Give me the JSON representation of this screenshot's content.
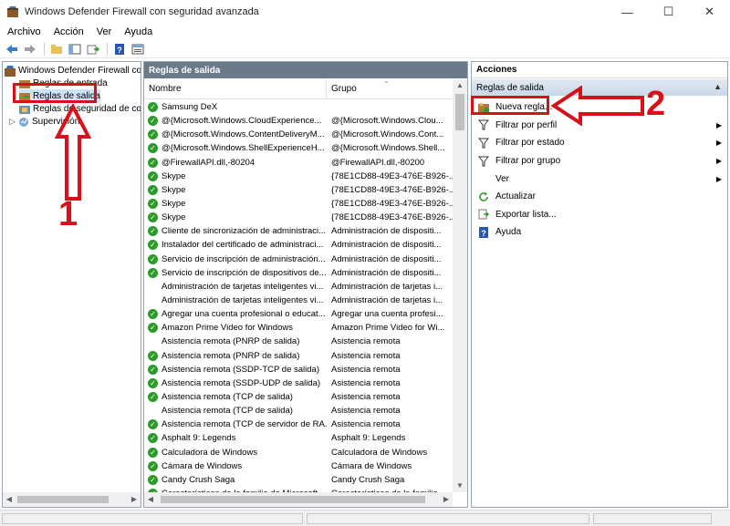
{
  "window": {
    "title": "Windows Defender Firewall con seguridad avanzada",
    "controls": [
      "minimize-icon",
      "maximize-icon",
      "close-icon"
    ]
  },
  "menu": [
    "Archivo",
    "Acción",
    "Ver",
    "Ayuda"
  ],
  "toolbar": [
    "back-icon",
    "forward-icon",
    "up-folder-icon",
    "show-hide-tree-icon",
    "export-icon",
    "help-icon",
    "properties-icon"
  ],
  "tree": {
    "root": "Windows Defender Firewall con",
    "items": [
      "Reglas de entrada",
      "Reglas de salida",
      "Reglas de seguridad de con",
      "Supervisión"
    ]
  },
  "middle": {
    "header": "Reglas de salida",
    "columns": {
      "name": "Nombre",
      "group": "Grupo"
    },
    "rows": [
      {
        "name": "Samsung DeX",
        "group": "",
        "enabled": true
      },
      {
        "name": "@{Microsoft.Windows.CloudExperience...",
        "group": "@{Microsoft.Windows.Clou...",
        "enabled": true
      },
      {
        "name": "@{Microsoft.Windows.ContentDeliveryM...",
        "group": "@{Microsoft.Windows.Cont...",
        "enabled": true
      },
      {
        "name": "@{Microsoft.Windows.ShellExperienceH...",
        "group": "@{Microsoft.Windows.Shell...",
        "enabled": true
      },
      {
        "name": "@FirewallAPI.dll,-80204",
        "group": "@FirewallAPI.dll,-80200",
        "enabled": true
      },
      {
        "name": "Skype",
        "group": "{78E1CD88-49E3-476E-B926-...",
        "enabled": true
      },
      {
        "name": "Skype",
        "group": "{78E1CD88-49E3-476E-B926-...",
        "enabled": true
      },
      {
        "name": "Skype",
        "group": "{78E1CD88-49E3-476E-B926-...",
        "enabled": true
      },
      {
        "name": "Skype",
        "group": "{78E1CD88-49E3-476E-B926-...",
        "enabled": true
      },
      {
        "name": "Cliente de sincronización de administraci...",
        "group": "Administración de dispositi...",
        "enabled": true
      },
      {
        "name": "Instalador del certificado de administraci...",
        "group": "Administración de dispositi...",
        "enabled": true
      },
      {
        "name": "Servicio de inscripción de administración...",
        "group": "Administración de dispositi...",
        "enabled": true
      },
      {
        "name": "Servicio de inscripción de dispositivos de...",
        "group": "Administración de dispositi...",
        "enabled": true
      },
      {
        "name": "Administración de tarjetas inteligentes vi...",
        "group": "Administración de tarjetas i...",
        "enabled": false
      },
      {
        "name": "Administración de tarjetas inteligentes vi...",
        "group": "Administración de tarjetas i...",
        "enabled": false
      },
      {
        "name": "Agregar una cuenta profesional o educat...",
        "group": "Agregar una cuenta profesi...",
        "enabled": true
      },
      {
        "name": "Amazon Prime Video for Windows",
        "group": "Amazon Prime Video for Wi...",
        "enabled": true
      },
      {
        "name": "Asistencia remota (PNRP de salida)",
        "group": "Asistencia remota",
        "enabled": false
      },
      {
        "name": "Asistencia remota (PNRP de salida)",
        "group": "Asistencia remota",
        "enabled": true
      },
      {
        "name": "Asistencia remota (SSDP-TCP de salida)",
        "group": "Asistencia remota",
        "enabled": true
      },
      {
        "name": "Asistencia remota (SSDP-UDP de salida)",
        "group": "Asistencia remota",
        "enabled": true
      },
      {
        "name": "Asistencia remota (TCP de salida)",
        "group": "Asistencia remota",
        "enabled": true
      },
      {
        "name": "Asistencia remota (TCP de salida)",
        "group": "Asistencia remota",
        "enabled": false
      },
      {
        "name": "Asistencia remota (TCP de servidor de RA...",
        "group": "Asistencia remota",
        "enabled": true
      },
      {
        "name": "Asphalt 9: Legends",
        "group": "Asphalt 9: Legends",
        "enabled": true
      },
      {
        "name": "Calculadora de Windows",
        "group": "Calculadora de Windows",
        "enabled": true
      },
      {
        "name": "Cámara de Windows",
        "group": "Cámara de Windows",
        "enabled": true
      },
      {
        "name": "Candy Crush Saga",
        "group": "Candy Crush Saga",
        "enabled": true
      },
      {
        "name": "Características de la familia de Microsoft",
        "group": "Características de la familia ...",
        "enabled": true
      }
    ]
  },
  "actions": {
    "header": "Acciones",
    "section": "Reglas de salida",
    "items": [
      {
        "label": "Nueva regla...",
        "icon": "new-rule-icon",
        "submenu": false
      },
      {
        "label": "Filtrar por perfil",
        "icon": "filter-icon",
        "submenu": true
      },
      {
        "label": "Filtrar por estado",
        "icon": "filter-icon",
        "submenu": true
      },
      {
        "label": "Filtrar por grupo",
        "icon": "filter-icon",
        "submenu": true
      },
      {
        "label": "Ver",
        "icon": "",
        "submenu": true
      },
      {
        "label": "Actualizar",
        "icon": "refresh-icon",
        "submenu": false
      },
      {
        "label": "Exportar lista...",
        "icon": "export-list-icon",
        "submenu": false
      },
      {
        "label": "Ayuda",
        "icon": "help-icon",
        "submenu": false
      }
    ]
  },
  "annotations": [
    "1",
    "2"
  ],
  "colors": {
    "accent_red": "#d6111a",
    "header_gray": "#6b7a88",
    "check_green": "#2d9a2a"
  }
}
